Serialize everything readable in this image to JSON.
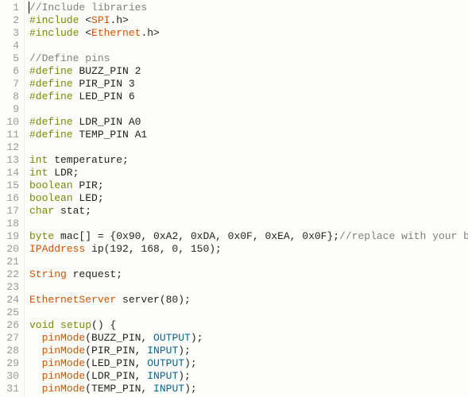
{
  "code": {
    "lines": [
      {
        "num": "1",
        "tokens": [
          {
            "cls": "cursor",
            "t": ""
          },
          {
            "cls": "comment",
            "t": "//Include libraries"
          }
        ]
      },
      {
        "num": "2",
        "tokens": [
          {
            "cls": "keyword",
            "t": "#include "
          },
          {
            "cls": "punct",
            "t": "<"
          },
          {
            "cls": "libtype",
            "t": "SPI"
          },
          {
            "cls": "punct",
            "t": ".h>"
          }
        ]
      },
      {
        "num": "3",
        "tokens": [
          {
            "cls": "keyword",
            "t": "#include "
          },
          {
            "cls": "punct",
            "t": "<"
          },
          {
            "cls": "libtype",
            "t": "Ethernet"
          },
          {
            "cls": "punct",
            "t": ".h>"
          }
        ]
      },
      {
        "num": "4",
        "tokens": [
          {
            "cls": "ident",
            "t": ""
          }
        ]
      },
      {
        "num": "5",
        "tokens": [
          {
            "cls": "comment",
            "t": "//Define pins"
          }
        ]
      },
      {
        "num": "6",
        "tokens": [
          {
            "cls": "keyword",
            "t": "#define"
          },
          {
            "cls": "ident",
            "t": " BUZZ_PIN 2"
          }
        ]
      },
      {
        "num": "7",
        "tokens": [
          {
            "cls": "keyword",
            "t": "#define"
          },
          {
            "cls": "ident",
            "t": " PIR_PIN 3"
          }
        ]
      },
      {
        "num": "8",
        "tokens": [
          {
            "cls": "keyword",
            "t": "#define"
          },
          {
            "cls": "ident",
            "t": " LED_PIN 6"
          }
        ]
      },
      {
        "num": "9",
        "tokens": [
          {
            "cls": "ident",
            "t": ""
          }
        ]
      },
      {
        "num": "10",
        "tokens": [
          {
            "cls": "keyword",
            "t": "#define"
          },
          {
            "cls": "ident",
            "t": " LDR_PIN A0"
          }
        ]
      },
      {
        "num": "11",
        "tokens": [
          {
            "cls": "keyword",
            "t": "#define"
          },
          {
            "cls": "ident",
            "t": " TEMP_PIN A1"
          }
        ]
      },
      {
        "num": "12",
        "tokens": [
          {
            "cls": "ident",
            "t": ""
          }
        ]
      },
      {
        "num": "13",
        "tokens": [
          {
            "cls": "type",
            "t": "int"
          },
          {
            "cls": "ident",
            "t": " temperature;"
          }
        ]
      },
      {
        "num": "14",
        "tokens": [
          {
            "cls": "type",
            "t": "int"
          },
          {
            "cls": "ident",
            "t": " LDR;"
          }
        ]
      },
      {
        "num": "15",
        "tokens": [
          {
            "cls": "type",
            "t": "boolean"
          },
          {
            "cls": "ident",
            "t": " PIR;"
          }
        ]
      },
      {
        "num": "16",
        "tokens": [
          {
            "cls": "type",
            "t": "boolean"
          },
          {
            "cls": "ident",
            "t": " LED;"
          }
        ]
      },
      {
        "num": "17",
        "tokens": [
          {
            "cls": "type",
            "t": "char"
          },
          {
            "cls": "ident",
            "t": " stat;"
          }
        ]
      },
      {
        "num": "18",
        "tokens": [
          {
            "cls": "ident",
            "t": ""
          }
        ]
      },
      {
        "num": "19",
        "tokens": [
          {
            "cls": "type",
            "t": "byte"
          },
          {
            "cls": "ident",
            "t": " mac[] = {0x90, 0xA2, 0xDA, 0x0F, 0xEA, 0x0F};"
          },
          {
            "cls": "comment",
            "t": "//replace with your board's"
          }
        ]
      },
      {
        "num": "20",
        "tokens": [
          {
            "cls": "libtype",
            "t": "IPAddress"
          },
          {
            "cls": "ident",
            "t": " ip(192, 168, 0, 150);"
          }
        ]
      },
      {
        "num": "21",
        "tokens": [
          {
            "cls": "ident",
            "t": ""
          }
        ]
      },
      {
        "num": "22",
        "tokens": [
          {
            "cls": "libtype",
            "t": "String"
          },
          {
            "cls": "ident",
            "t": " request;"
          }
        ]
      },
      {
        "num": "23",
        "tokens": [
          {
            "cls": "ident",
            "t": ""
          }
        ]
      },
      {
        "num": "24",
        "tokens": [
          {
            "cls": "libtype",
            "t": "EthernetServer"
          },
          {
            "cls": "ident",
            "t": " server(80);"
          }
        ]
      },
      {
        "num": "25",
        "tokens": [
          {
            "cls": "ident",
            "t": ""
          }
        ]
      },
      {
        "num": "26",
        "tokens": [
          {
            "cls": "type",
            "t": "void"
          },
          {
            "cls": "ident",
            "t": " "
          },
          {
            "cls": "type",
            "t": "setup"
          },
          {
            "cls": "ident",
            "t": "() {"
          }
        ]
      },
      {
        "num": "27",
        "tokens": [
          {
            "cls": "ident",
            "t": "  "
          },
          {
            "cls": "func",
            "t": "pinMode"
          },
          {
            "cls": "ident",
            "t": "(BUZZ_PIN, "
          },
          {
            "cls": "const",
            "t": "OUTPUT"
          },
          {
            "cls": "ident",
            "t": ");"
          }
        ]
      },
      {
        "num": "28",
        "tokens": [
          {
            "cls": "ident",
            "t": "  "
          },
          {
            "cls": "func",
            "t": "pinMode"
          },
          {
            "cls": "ident",
            "t": "(PIR_PIN, "
          },
          {
            "cls": "const",
            "t": "INPUT"
          },
          {
            "cls": "ident",
            "t": ");"
          }
        ]
      },
      {
        "num": "29",
        "tokens": [
          {
            "cls": "ident",
            "t": "  "
          },
          {
            "cls": "func",
            "t": "pinMode"
          },
          {
            "cls": "ident",
            "t": "(LED_PIN, "
          },
          {
            "cls": "const",
            "t": "OUTPUT"
          },
          {
            "cls": "ident",
            "t": ");"
          }
        ]
      },
      {
        "num": "30",
        "tokens": [
          {
            "cls": "ident",
            "t": "  "
          },
          {
            "cls": "func",
            "t": "pinMode"
          },
          {
            "cls": "ident",
            "t": "(LDR_PIN, "
          },
          {
            "cls": "const",
            "t": "INPUT"
          },
          {
            "cls": "ident",
            "t": ");"
          }
        ]
      },
      {
        "num": "31",
        "tokens": [
          {
            "cls": "ident",
            "t": "  "
          },
          {
            "cls": "func",
            "t": "pinMode"
          },
          {
            "cls": "ident",
            "t": "(TEMP_PIN, "
          },
          {
            "cls": "const",
            "t": "INPUT"
          },
          {
            "cls": "ident",
            "t": ");"
          }
        ]
      }
    ]
  }
}
